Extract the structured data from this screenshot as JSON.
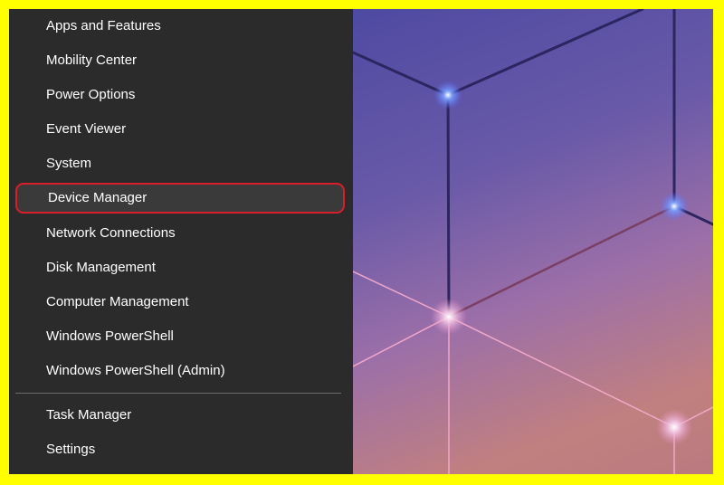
{
  "winx_menu": {
    "items": [
      {
        "label": "Apps and Features"
      },
      {
        "label": "Mobility Center"
      },
      {
        "label": "Power Options"
      },
      {
        "label": "Event Viewer"
      },
      {
        "label": "System"
      },
      {
        "label": "Device Manager",
        "highlighted": true
      },
      {
        "label": "Network Connections"
      },
      {
        "label": "Disk Management"
      },
      {
        "label": "Computer Management"
      },
      {
        "label": "Windows PowerShell"
      },
      {
        "label": "Windows PowerShell (Admin)"
      },
      {
        "label": "Task Manager"
      },
      {
        "label": "Settings"
      }
    ]
  },
  "colors": {
    "frame_border": "#ffff00",
    "menu_background": "#2b2b2b",
    "highlight_outline": "#d81e2a"
  }
}
